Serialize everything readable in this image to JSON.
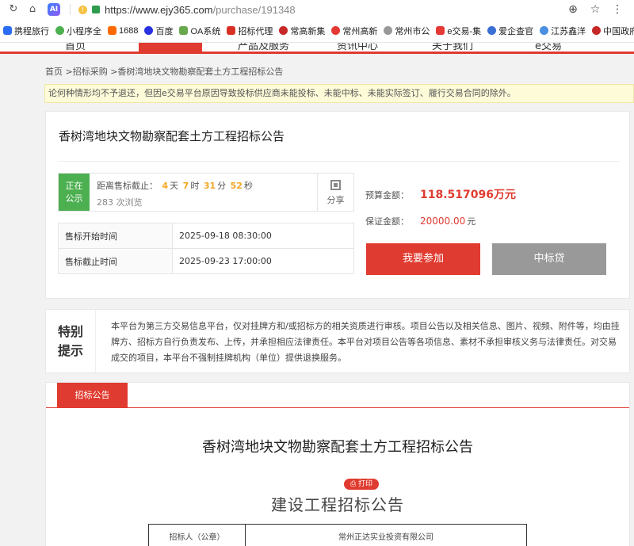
{
  "browser": {
    "url_host": "https://www.ejy365.com",
    "url_path": "/purchase/191348",
    "ai_label": "AI",
    "bookmarks": [
      {
        "label": "携程旅行",
        "color": "#2a6df4"
      },
      {
        "label": "小程序全",
        "color": "#4caf50"
      },
      {
        "label": "1688",
        "color": "#ff6a00"
      },
      {
        "label": "百度",
        "color": "#2932e1"
      },
      {
        "label": "OA系统",
        "color": "#6aa84f"
      },
      {
        "label": "招标代理",
        "color": "#d93025"
      },
      {
        "label": "常高新集",
        "color": "#c62828"
      },
      {
        "label": "常州高新",
        "color": "#e53935"
      },
      {
        "label": "常州市公",
        "color": "#999999"
      },
      {
        "label": "e交易-集",
        "color": "#e53935"
      },
      {
        "label": "爱企查官",
        "color": "#3b6fd4"
      },
      {
        "label": "江苏鑫洋",
        "color": "#4a90e2"
      },
      {
        "label": "中国政府",
        "color": "#c62828"
      }
    ]
  },
  "site_nav": {
    "items": [
      "首页",
      "招标采购",
      "产品及服务",
      "资讯中心",
      "关于我们",
      "e交易"
    ]
  },
  "breadcrumb": "首页 >招标采购 >香树湾地块文物勘察配套土方工程招标公告",
  "notice_text": "论何种情形均不予退还，但因e交易平台原因导致投标供应商未能投标、未能中标、未能实际签订、履行交易合同的除外。",
  "project": {
    "title": "香树湾地块文物勘察配套土方工程招标公告",
    "status": [
      "正在",
      "公示"
    ],
    "countdown_label": "距离售标截止：",
    "countdown": {
      "days": "4",
      "days_unit": "天",
      "hours": "7",
      "hours_unit": "时",
      "minutes": "31",
      "minutes_unit": "分",
      "seconds": "52",
      "seconds_unit": "秒"
    },
    "views": "283 次浏览",
    "share_label": "分享",
    "rows": [
      {
        "key": "售标开始时间",
        "value": "2025-09-18 08:30:00"
      },
      {
        "key": "售标截止时间",
        "value": "2025-09-23 17:00:00"
      }
    ],
    "budget_label": "预算金额：",
    "budget_value": "118.517096万元",
    "deposit_label": "保证金额：",
    "deposit_value": "20000.00",
    "deposit_unit": "元",
    "join_button": "我要参加",
    "loan_button": "中标贷"
  },
  "tip": {
    "title_line1": "特别",
    "title_line2": "提示",
    "body": "本平台为第三方交易信息平台，仅对挂牌方和/或招标方的相关资质进行审核。项目公告以及相关信息、图片、视频、附件等，均由挂牌方、招标方自行负责发布、上传，并承担相应法律责任。本平台对项目公告等各项信息、素材不承担审核义务与法律责任。对交易成交的项目，本平台不强制挂牌机构（单位）提供退换服务。"
  },
  "document": {
    "tab_label": "招标公告",
    "title": "香树湾地块文物勘察配套土方工程招标公告",
    "print_label": "打印",
    "subtitle": "建设工程招标公告",
    "table": [
      {
        "key": "招标人（公章）",
        "value": "常州正达实业投资有限公司"
      }
    ]
  }
}
